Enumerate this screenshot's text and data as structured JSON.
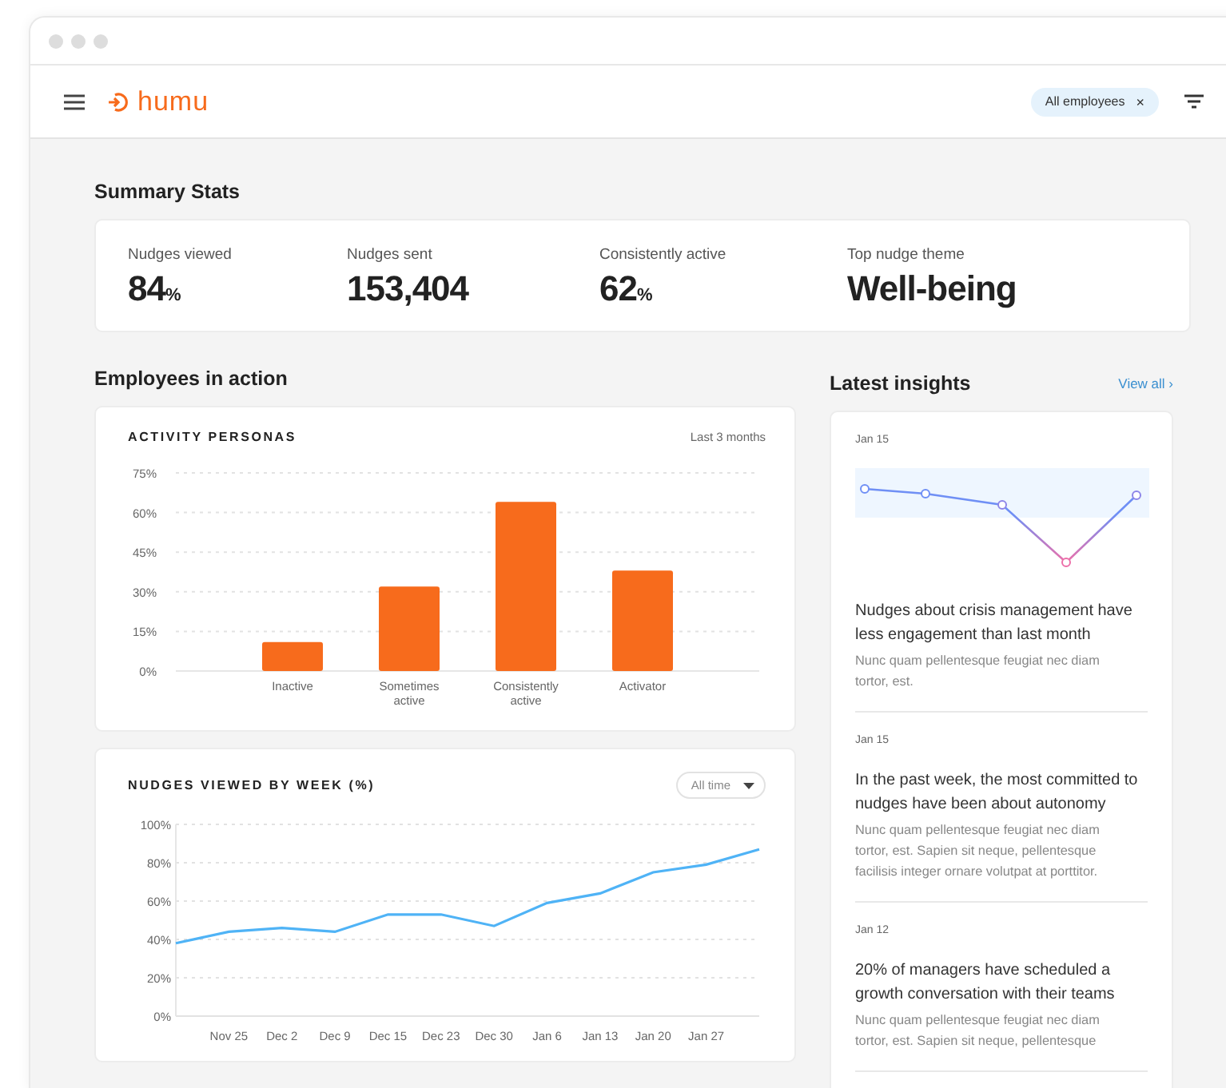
{
  "header": {
    "logo": "humu",
    "filter_chip": {
      "label": "All employees",
      "close": "×"
    }
  },
  "summary": {
    "title": "Summary Stats",
    "stats": [
      {
        "label": "Nudges viewed",
        "value": "84",
        "unit": "%"
      },
      {
        "label": "Nudges sent",
        "value": "153,404"
      },
      {
        "label": "Consistently active",
        "value": "62",
        "unit": "%"
      },
      {
        "label": "Top nudge theme",
        "value": "Well-being"
      }
    ]
  },
  "employees": {
    "title": "Employees in action",
    "personas": {
      "title": "ACTIVITY PERSONAS",
      "period": "Last 3 months",
      "chart_data": {
        "type": "bar",
        "categories": [
          "Inactive",
          "Sometimes active",
          "Consistently active",
          "Activator"
        ],
        "values": [
          11,
          32,
          64,
          38
        ],
        "grid": true,
        "ylim": [
          0,
          75
        ],
        "yticks": [
          {
            "value": 0,
            "label": "0%"
          },
          {
            "value": 15,
            "label": "15%"
          },
          {
            "value": 30,
            "label": "30%"
          },
          {
            "value": 45,
            "label": "45%"
          },
          {
            "value": 60,
            "label": "60%"
          },
          {
            "value": 75,
            "label": "75%"
          }
        ]
      }
    },
    "weekly": {
      "title": "NUDGES VIEWED BY WEEK (%)",
      "range": "All time",
      "chart_data": {
        "type": "line",
        "categories": [
          null,
          "Nov 25",
          "Dec 2",
          "Dec 9",
          "Dec 15",
          "Dec 23",
          "Dec 30",
          "Jan 6",
          "Jan 13",
          "Jan 20",
          "Jan 27",
          null
        ],
        "grid": true,
        "ylim": [
          0,
          100
        ],
        "yticks": [
          {
            "value": 0,
            "label": "0%"
          },
          {
            "value": 20,
            "label": "20%"
          },
          {
            "value": 40,
            "label": "40%"
          },
          {
            "value": 60,
            "label": "60%"
          },
          {
            "value": 80,
            "label": "80%"
          },
          {
            "value": 100,
            "label": "100%"
          }
        ],
        "values": [
          38,
          44,
          46,
          44,
          53,
          53,
          47,
          59,
          64,
          75,
          79,
          87
        ]
      }
    }
  },
  "insights": {
    "title": "Latest insights",
    "view_all": "View all ›",
    "items": [
      {
        "kind": "sparkline",
        "date": "Jan 15",
        "title": "Nudges about crisis management have less engagement than last month",
        "body": "Nunc quam pellentesque feugiat nec diam tortor, est."
      },
      {
        "kind": "text",
        "date": "Jan 15",
        "title": "In the past week, the most committed to nudges have been about autonomy",
        "body": "Nunc quam pellentesque feugiat nec diam tortor, est. Sapien sit neque, pellentesque facilisis integer ornare volutpat at porttitor."
      },
      {
        "kind": "text",
        "date": "Jan 12",
        "title": "20% of managers have scheduled a growth conversation with their teams",
        "body": "Nunc quam pellentesque feugiat nec diam tortor, est. Sapien sit neque, pellentesque"
      }
    ]
  }
}
